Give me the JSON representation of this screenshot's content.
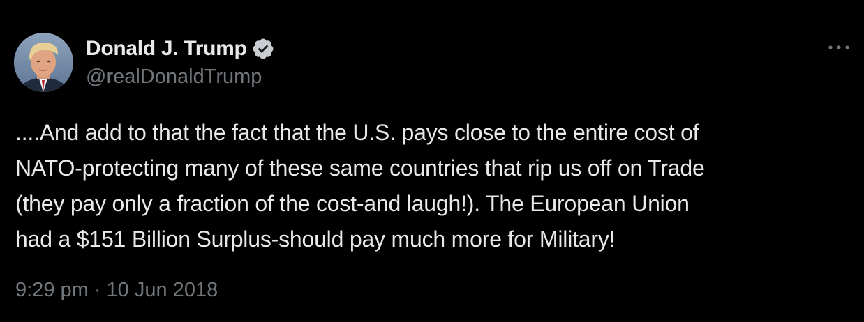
{
  "author": {
    "display_name": "Donald J. Trump",
    "handle": "@realDonaldTrump",
    "verified_icon": "verified-badge-icon",
    "avatar": "avatar-photo"
  },
  "tweet": {
    "text_lines": [
      "....And add to that the fact that the U.S. pays close to the entire cost of",
      "NATO-protecting many of these same countries that rip us off on Trade",
      "(they pay only a fraction of the cost-and laugh!). The European Union",
      "had a $151 Billion Surplus-should pay much more for Military!"
    ],
    "timestamp": "9:29 pm · 10 Jun 2018"
  },
  "icons": {
    "more": "more-options-icon"
  },
  "colors": {
    "background": "#000000",
    "primary_text": "#e7e9ea",
    "secondary_text": "#71767b"
  }
}
